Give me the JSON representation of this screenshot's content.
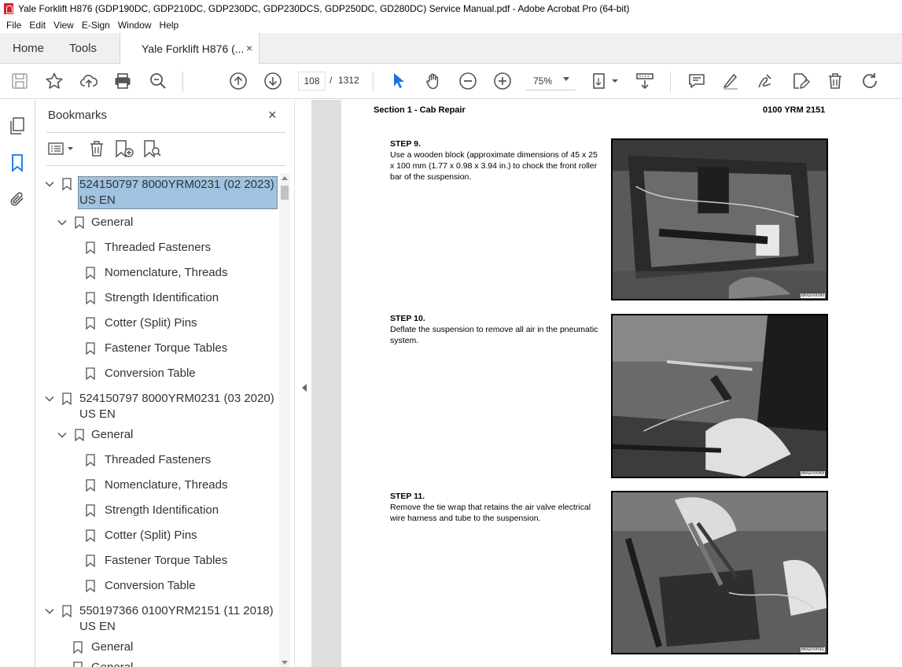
{
  "window": {
    "title": "Yale Forklift H876 (GDP190DC, GDP210DC, GDP230DC, GDP230DCS, GDP250DC, GD280DC) Service Manual.pdf - Adobe Acrobat Pro (64-bit)"
  },
  "menu": [
    "File",
    "Edit",
    "View",
    "E-Sign",
    "Window",
    "Help"
  ],
  "tabs": {
    "home": "Home",
    "tools": "Tools",
    "doc": "Yale Forklift H876 (...",
    "close": "×"
  },
  "toolbar": {
    "page_current": "108",
    "page_sep": "/",
    "page_total": "1312",
    "zoom": "75%"
  },
  "bookmarks": {
    "title": "Bookmarks",
    "close": "×",
    "items": [
      {
        "label": "524150797 8000YRM0231 (02 2023)",
        "label2": "US EN"
      },
      {
        "label": "General"
      },
      {
        "label": "Threaded Fasteners"
      },
      {
        "label": "Nomenclature, Threads"
      },
      {
        "label": "Strength Identification"
      },
      {
        "label": "Cotter (Split) Pins"
      },
      {
        "label": "Fastener Torque Tables"
      },
      {
        "label": "Conversion Table"
      },
      {
        "label": "524150797 8000YRM0231 (03 2020)",
        "label2": "US EN"
      },
      {
        "label": "General"
      },
      {
        "label": "Threaded Fasteners"
      },
      {
        "label": "Nomenclature, Threads"
      },
      {
        "label": "Strength Identification"
      },
      {
        "label": "Cotter (Split) Pins"
      },
      {
        "label": "Fastener Torque Tables"
      },
      {
        "label": "Conversion Table"
      },
      {
        "label": "550197366 0100YRM2151 (11 2018)",
        "label2": "US EN"
      },
      {
        "label": "General"
      },
      {
        "label": "General"
      }
    ]
  },
  "document": {
    "header_left": "Section 1 - Cab Repair",
    "header_right": "0100 YRM 2151",
    "steps": [
      {
        "title": "STEP 9.",
        "text": "Use a wooden block (approximate dimensions of 45 x 25 x 100 mm (1.77 x 0.98 x 3.94 in.) to chock the front roller bar of the suspension.",
        "figure": "BM200090"
      },
      {
        "title": "STEP 10.",
        "text": "Deflate the suspension to remove all air in the pneumatic system.",
        "figure": "BM200089"
      },
      {
        "title": "STEP 11.",
        "text": "Remove the tie wrap that retains the air valve electrical wire harness and tube to the suspension.",
        "figure": "BM200091"
      }
    ]
  },
  "colors": {
    "accent": "#1473e6",
    "selection": "#9fc3e0",
    "pdf_red": "#d2232a"
  }
}
